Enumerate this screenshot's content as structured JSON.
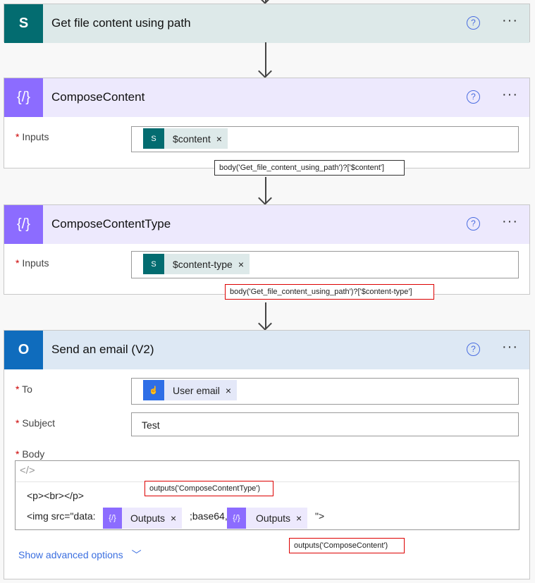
{
  "steps": [
    {
      "title": "Get file content using path",
      "icon": "sharepoint-icon",
      "color": "#036c70",
      "header_bg": "#dde9e9"
    },
    {
      "title": "ComposeContent",
      "icon": "compose-icon",
      "color": "#8c6cff",
      "header_bg": "#ede9fd",
      "inputs_label": "Inputs",
      "token": "$content",
      "tooltip": "body('Get_file_content_using_path')?['$content']"
    },
    {
      "title": "ComposeContentType",
      "icon": "compose-icon",
      "color": "#8c6cff",
      "header_bg": "#ede9fd",
      "inputs_label": "Inputs",
      "token": "$content-type",
      "tooltip": "body('Get_file_content_using_path')?['$content-type']"
    },
    {
      "title": "Send an email (V2)",
      "icon": "outlook-icon",
      "color": "#0f6cbd",
      "header_bg": "#dde8f4",
      "to_label": "To",
      "to_token": "User email",
      "subject_label": "Subject",
      "subject_value": "Test",
      "body_label": "Body",
      "code_icon": "</>",
      "body_line1": "<p><br></p>",
      "body_line2_pre": "<img src=\"data:",
      "token_outputs": "Outputs",
      "body_mid": ";base64,",
      "body_end": "\">",
      "tooltip_type": "outputs('ComposeContentType')",
      "tooltip_content": "outputs('ComposeContent')",
      "advanced": "Show advanced options"
    }
  ],
  "help": "?",
  "more": "···",
  "remove": "×",
  "required": "*"
}
